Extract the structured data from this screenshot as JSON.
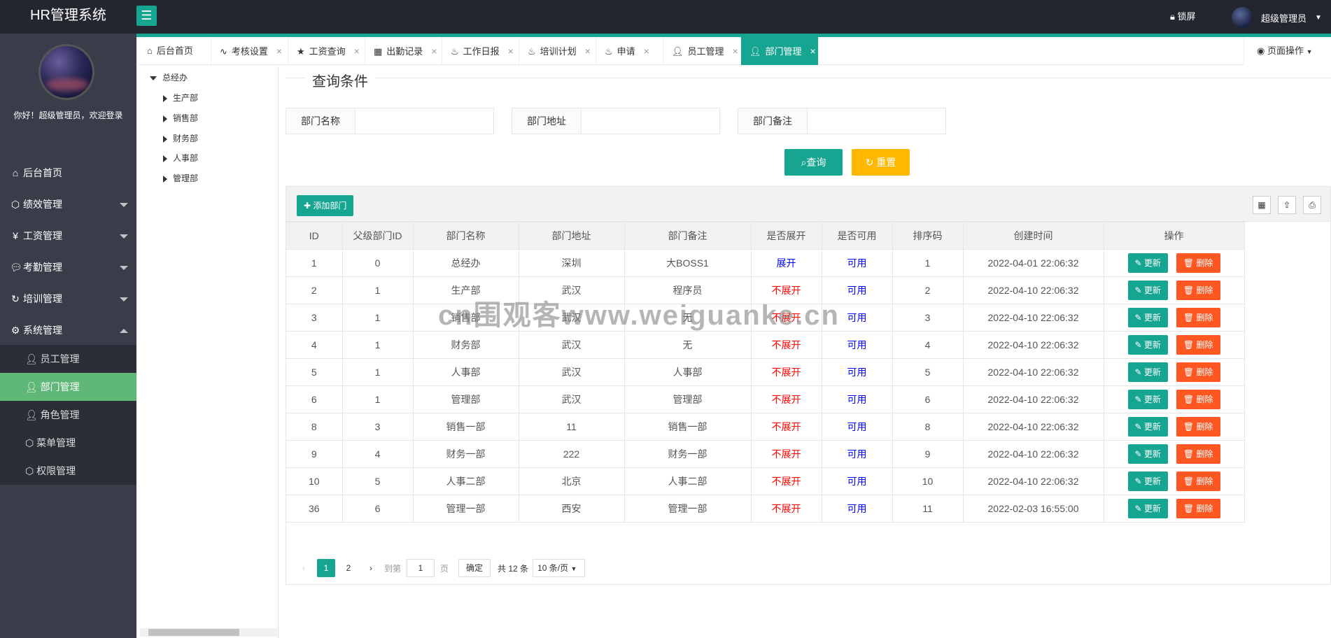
{
  "app": {
    "title": "HR管理系统",
    "lock_label": "锁屏",
    "user_name": "超级管理员"
  },
  "sidebar": {
    "welcome": "你好！超级管理员，欢迎登录",
    "items": [
      {
        "label": "后台首页",
        "icon": "home-icon"
      },
      {
        "label": "绩效管理",
        "icon": "cube-icon"
      },
      {
        "label": "工资管理",
        "icon": "yen-icon"
      },
      {
        "label": "考勤管理",
        "icon": "chat-icon"
      },
      {
        "label": "培训管理",
        "icon": "refresh-icon"
      },
      {
        "label": "系统管理",
        "icon": "gear-icon"
      }
    ],
    "sub_items": [
      {
        "label": "员工管理"
      },
      {
        "label": "部门管理"
      },
      {
        "label": "角色管理"
      },
      {
        "label": "菜单管理"
      },
      {
        "label": "权限管理"
      }
    ]
  },
  "tabs": [
    {
      "label": "后台首页"
    },
    {
      "label": "考核设置"
    },
    {
      "label": "工资查询"
    },
    {
      "label": "出勤记录"
    },
    {
      "label": "工作日报"
    },
    {
      "label": "培训计划"
    },
    {
      "label": "申请"
    },
    {
      "label": "员工管理"
    },
    {
      "label": "部门管理"
    }
  ],
  "tab_close": "×",
  "page_ops": "页面操作",
  "tree": {
    "root": "总经办",
    "children": [
      "生产部",
      "销售部",
      "财务部",
      "人事部",
      "管理部"
    ]
  },
  "query": {
    "title": "查询条件",
    "fields": [
      {
        "label": "部门名称",
        "value": ""
      },
      {
        "label": "部门地址",
        "value": ""
      },
      {
        "label": "部门备注",
        "value": ""
      }
    ],
    "search_label": "查询",
    "reset_label": "重置"
  },
  "table": {
    "add_label": "添加部门",
    "headers": [
      "ID",
      "父级部门ID",
      "部门名称",
      "部门地址",
      "部门备注",
      "是否展开",
      "是否可用",
      "排序码",
      "创建时间",
      "操作"
    ],
    "rows": [
      [
        "1",
        "0",
        "总经办",
        "深圳",
        "大BOSS1",
        "展开",
        "可用",
        "1",
        "2022-04-01 22:06:32"
      ],
      [
        "2",
        "1",
        "生产部",
        "武汉",
        "程序员",
        "不展开",
        "可用",
        "2",
        "2022-04-10 22:06:32"
      ],
      [
        "3",
        "1",
        "销售部",
        "武汉",
        "无",
        "不展开",
        "可用",
        "3",
        "2022-04-10 22:06:32"
      ],
      [
        "4",
        "1",
        "财务部",
        "武汉",
        "无",
        "不展开",
        "可用",
        "4",
        "2022-04-10 22:06:32"
      ],
      [
        "5",
        "1",
        "人事部",
        "武汉",
        "人事部",
        "不展开",
        "可用",
        "5",
        "2022-04-10 22:06:32"
      ],
      [
        "6",
        "1",
        "管理部",
        "武汉",
        "管理部",
        "不展开",
        "可用",
        "6",
        "2022-04-10 22:06:32"
      ],
      [
        "8",
        "3",
        "销售一部",
        "11",
        "销售一部",
        "不展开",
        "可用",
        "8",
        "2022-04-10 22:06:32"
      ],
      [
        "9",
        "4",
        "财务一部",
        "222",
        "财务一部",
        "不展开",
        "可用",
        "9",
        "2022-04-10 22:06:32"
      ],
      [
        "10",
        "5",
        "人事二部",
        "北京",
        "人事二部",
        "不展开",
        "可用",
        "10",
        "2022-04-10 22:06:32"
      ],
      [
        "36",
        "6",
        "管理一部",
        "西安",
        "管理一部",
        "不展开",
        "可用",
        "11",
        "2022-02-03 16:55:00"
      ]
    ],
    "update_label": "更新",
    "delete_label": "删除"
  },
  "pager": {
    "pages": [
      "1",
      "2"
    ],
    "current": "1",
    "goto_prefix": "到第",
    "goto_value": "1",
    "goto_suffix": "页",
    "confirm": "确定",
    "total": "共 12 条",
    "page_size": "10 条/页"
  },
  "watermark": "cn围观客www.weiguanke.cn",
  "colors": {
    "accent": "#16a590",
    "sidebar": "#393d49",
    "header": "#23262e",
    "active_sub": "#5fb878",
    "danger": "#ff5722",
    "warn": "#ffb800"
  }
}
